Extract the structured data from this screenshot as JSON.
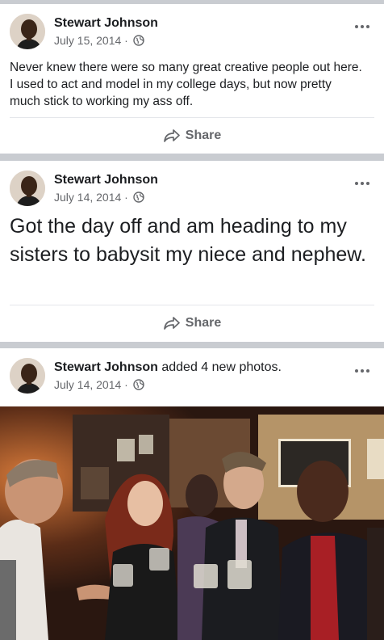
{
  "posts": [
    {
      "author": "Stewart Johnson",
      "date": "July 15, 2014 ·",
      "text": "Never knew there were so many great creative people out here.  I used to act and model in my college days, but now pretty much stick to working my ass off.",
      "share_label": "Share"
    },
    {
      "author": "Stewart Johnson",
      "date": "July 14, 2014 ·",
      "text": "Got the day off and am heading to my sisters to babysit my niece and nephew.",
      "share_label": "Share"
    },
    {
      "author": "Stewart Johnson",
      "action": "added 4 new photos.",
      "date": "July 14, 2014 ·"
    }
  ],
  "icons": {
    "privacy": "globe-icon",
    "more": "more-options-icon",
    "share": "share-arrow-icon"
  },
  "colors": {
    "separator": "#c9ccd1",
    "meta_text": "#65676b",
    "card": "#ffffff"
  }
}
